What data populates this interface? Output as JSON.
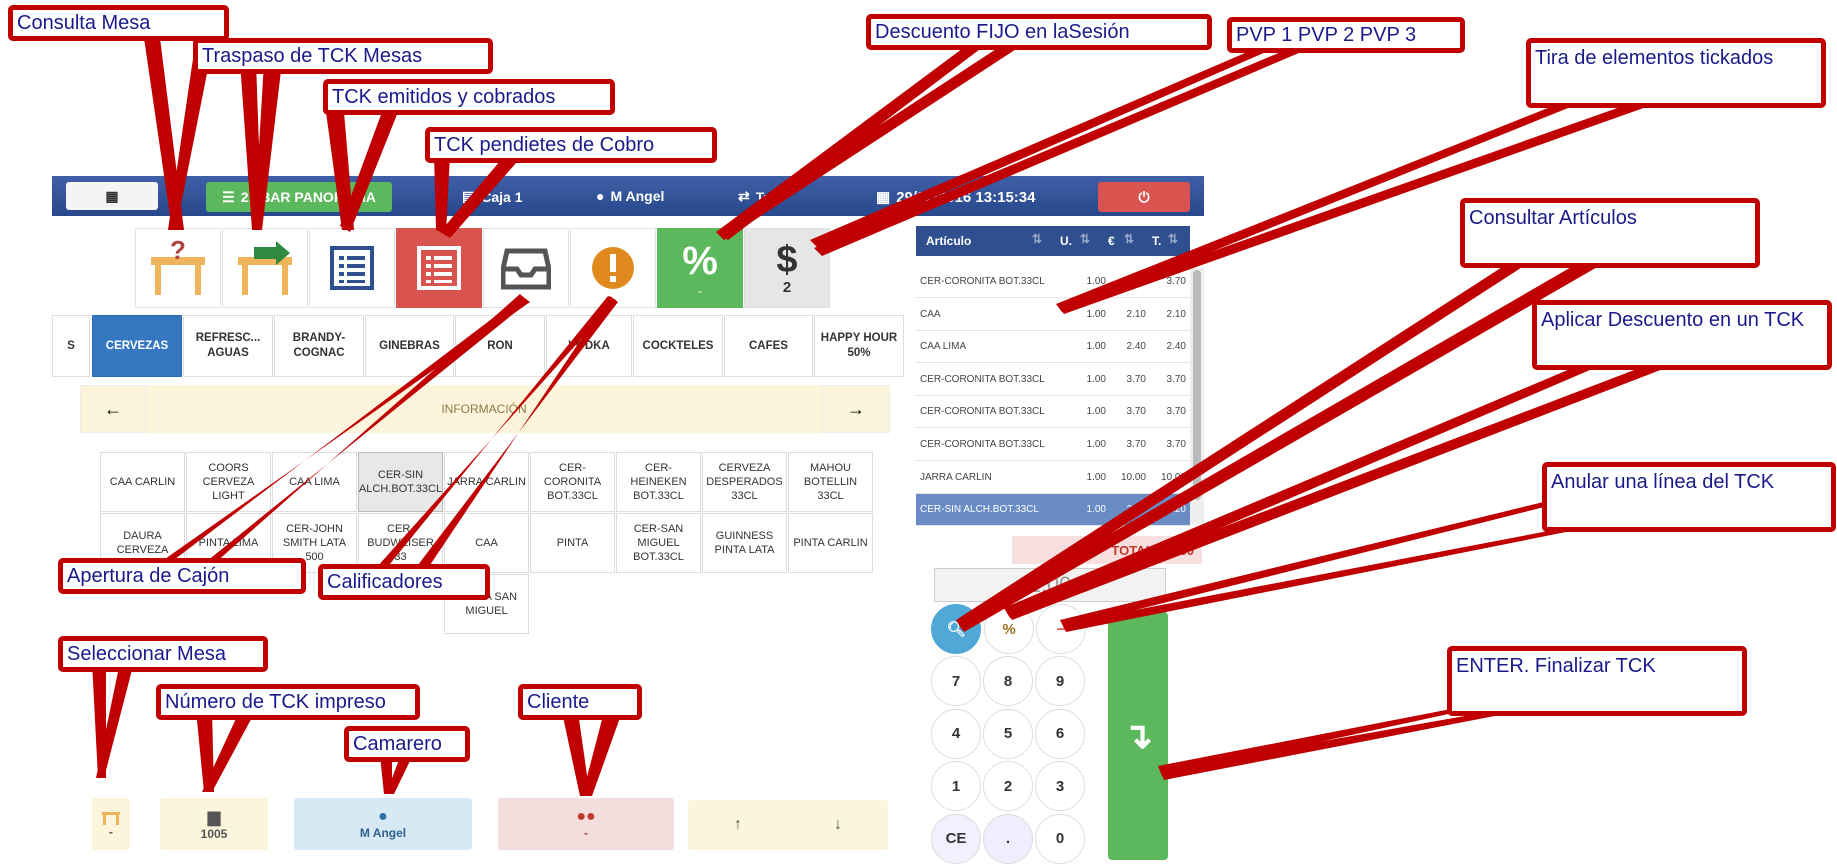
{
  "topbar": {
    "grid_btn": "▦",
    "table_btn": "21 BAR PANORAMA",
    "caja": "Caja 1",
    "user": "M Angel",
    "tables": "T: 0",
    "datetime": "29/02/2016 13:15:34"
  },
  "tools": {
    "discount_sub": "-",
    "pvp_value": "2"
  },
  "categories": [
    "S",
    "CERVEZAS",
    "REFRESC... AGUAS",
    "BRANDY- COGNAC",
    "GINEBRAS",
    "RON",
    "VODKA",
    "COCKTELES",
    "CAFES",
    "HAPPY HOUR 50%"
  ],
  "info_bar": "INFORMACIÓN",
  "products": [
    "CAA CARLIN",
    "COORS CERVEZA LIGHT",
    "CAA LIMA",
    "CER-SIN ALCH.BOT.33CL",
    "JARRA CARLIN",
    "CER-CORONITA BOT.33CL",
    "CER-HEINEKEN BOT.33CL",
    "CERVEZA DESPERADOS 33CL",
    "MAHOU BOTELLIN 33CL",
    "DAURA CERVEZA",
    "PINTA LIMA",
    "CER-JOHN SMITH LATA 500",
    "CER-BUDWEISER 33",
    "CAA",
    "PINTA",
    "CER-SAN MIGUEL BOT.33CL",
    "GUINNESS PINTA LATA",
    "PINTA CARLIN",
    "JARRA SAN MIGUEL"
  ],
  "ticket": {
    "headers": [
      "Artículo",
      "U.",
      "€",
      "T."
    ],
    "rows": [
      [
        "CER-CORONITA BOT.33CL",
        "1.00",
        "3.70",
        "3.70"
      ],
      [
        "CAA",
        "1.00",
        "2.10",
        "2.10"
      ],
      [
        "CAA LIMA",
        "1.00",
        "2.40",
        "2.40"
      ],
      [
        "CER-CORONITA BOT.33CL",
        "1.00",
        "3.70",
        "3.70"
      ],
      [
        "CER-CORONITA BOT.33CL",
        "1.00",
        "3.70",
        "3.70"
      ],
      [
        "CER-CORONITA BOT.33CL",
        "1.00",
        "3.70",
        "3.70"
      ],
      [
        "JARRA CARLIN",
        "1.00",
        "10.00",
        "10.00"
      ],
      [
        "CER-SIN ALCH.BOT.33CL",
        "1.00",
        "2.20",
        "2.20"
      ]
    ],
    "total": "TOTAL: 33.50",
    "qty": "1.00"
  },
  "keypad": [
    "7",
    "8",
    "9",
    "4",
    "5",
    "6",
    "1",
    "2",
    "3",
    "CE",
    ".",
    "0"
  ],
  "bottom": {
    "mesa": "-",
    "tck_num": "1005",
    "camarero": "M Angel",
    "cliente": "-"
  },
  "callouts": {
    "consulta_mesa": "Consulta Mesa",
    "traspaso": "Traspaso de TCK Mesas",
    "emitidos": "TCK emitidos y cobrados",
    "pendientes": "TCK pendietes de Cobro",
    "descuento_fijo": "Descuento FIJO en laSesión",
    "pvp": "PVP 1 PVP 2 PVP 3",
    "tira": "Tira de elementos tickados",
    "consultar_articulos": "Consultar Artículos",
    "aplicar_descuento": "Aplicar Descuento en un TCK",
    "anular_linea": "Anular una línea del TCK",
    "enter": "ENTER. Finalizar TCK",
    "apertura_cajon": "Apertura de Cajón",
    "calificadores": "Calificadores",
    "seleccionar_mesa": "Seleccionar Mesa",
    "numero_tck": "Número de TCK impreso",
    "camarero": "Camarero",
    "cliente": "Cliente"
  },
  "colors": {
    "accent": "#3578c1",
    "brand": "#2f4f8f",
    "callout": "#c00000",
    "green": "#5cb85c",
    "red": "#d9534f"
  }
}
